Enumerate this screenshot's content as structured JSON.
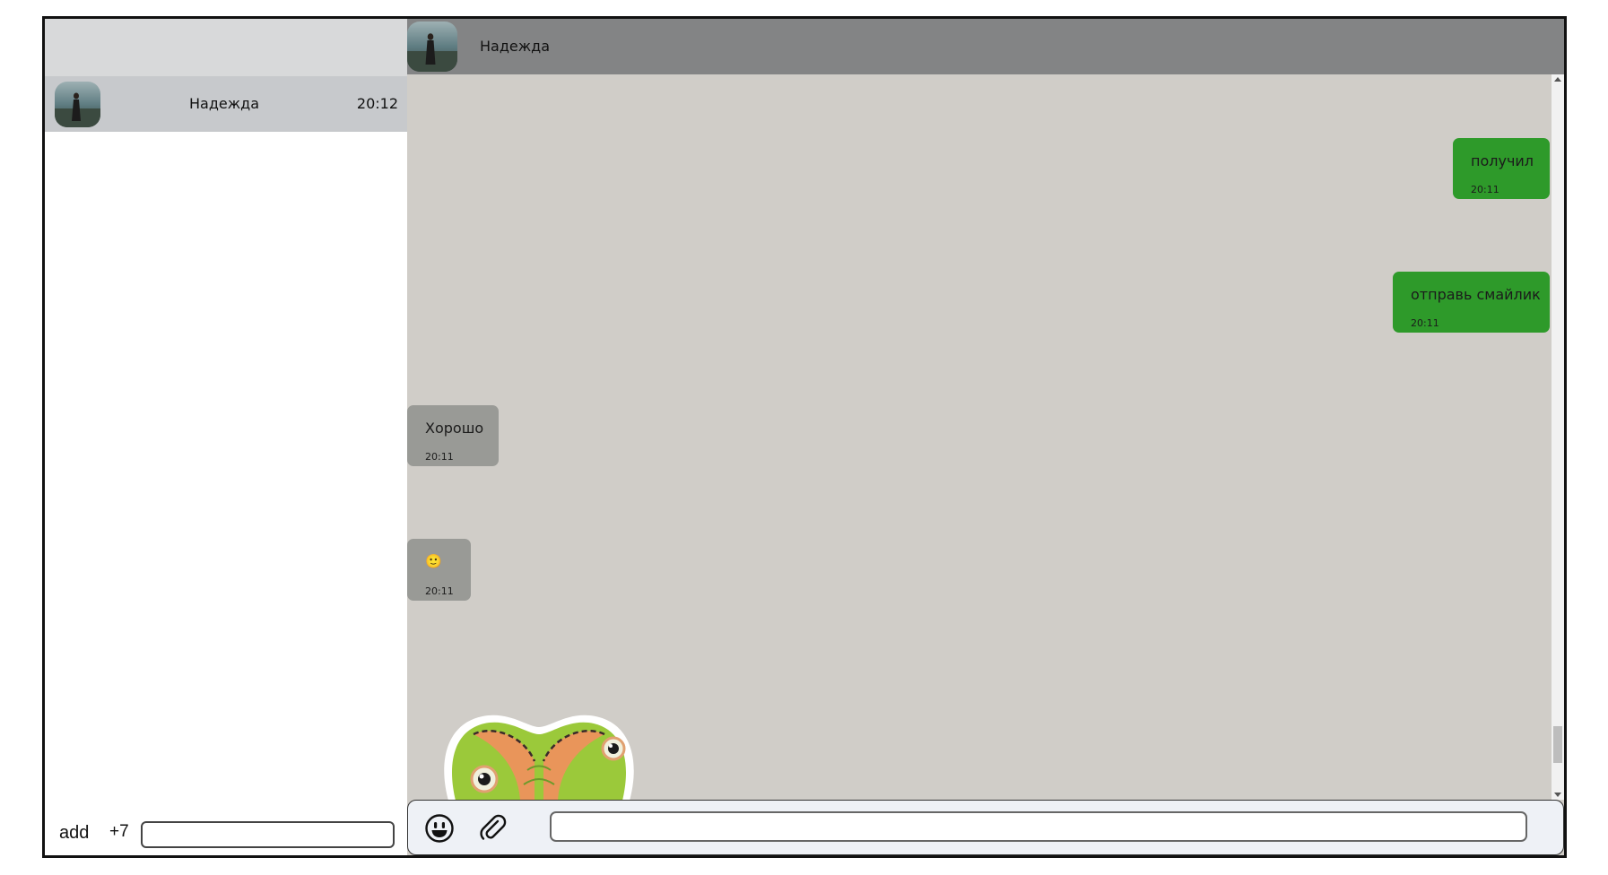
{
  "sidebar": {
    "contact": {
      "name": "Надежда",
      "time": "20:12"
    },
    "add_label": "add",
    "country_code": "+7",
    "phone_value": ""
  },
  "chat": {
    "header_name": "Надежда",
    "messages": [
      {
        "direction": "out",
        "text": "получил",
        "time": "20:11"
      },
      {
        "direction": "out",
        "text": "отправь смайлик",
        "time": "20:11"
      },
      {
        "direction": "in",
        "text": "Хорошо",
        "time": "20:11"
      },
      {
        "direction": "in",
        "text": "🙂",
        "time": "20:11"
      }
    ],
    "sticker_icon": "cartoon-creature-sticker-icon",
    "composer_value": ""
  },
  "icons": {
    "emoji": "smiley-face-icon",
    "attach": "paperclip-icon"
  },
  "colors": {
    "outgoing_bubble": "#2e9a2a",
    "incoming_bubble": "#999a96",
    "chat_background": "#d0cdc8",
    "header_background": "#838485",
    "selected_contact": "#c7c9cc"
  }
}
